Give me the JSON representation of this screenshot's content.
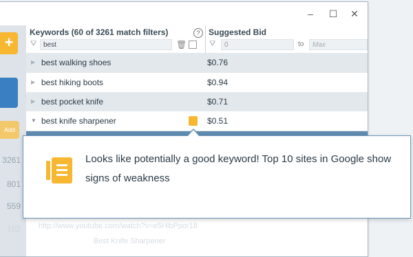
{
  "window": {
    "controls": {
      "minimize": "–",
      "maximize": "☐",
      "close": "✕"
    }
  },
  "sidebar": {
    "plus": "+",
    "add": "Add",
    "counts": [
      "3261",
      "801",
      "559",
      "162"
    ]
  },
  "table": {
    "keywords_header": "Keywords (60 of 3261 match filters)",
    "help": "?",
    "bid_header": "Suggested Bid",
    "keyword_filter": "best",
    "bid_min_placeholder": "0",
    "bid_to": "to",
    "bid_max_placeholder": "Max",
    "rows": [
      {
        "keyword": "best walking shoes",
        "bid": "$0.76"
      },
      {
        "keyword": "best hiking boots",
        "bid": "$0.94"
      },
      {
        "keyword": "best pocket knife",
        "bid": "$0.71"
      },
      {
        "keyword": "best knife sharpener",
        "bid": "$0.51"
      }
    ]
  },
  "background": {
    "url_text": "http://www.youtube.com/watch?v=e5HlbPpor18",
    "title_text": "Best Knife Sharpener"
  },
  "tooltip": {
    "text": "Looks like potentially a good keyword! Top 10 sites in Google show signs of weakness",
    "icon": "document-icon",
    "accent": "#f7b731",
    "border": "#6b94b8"
  }
}
